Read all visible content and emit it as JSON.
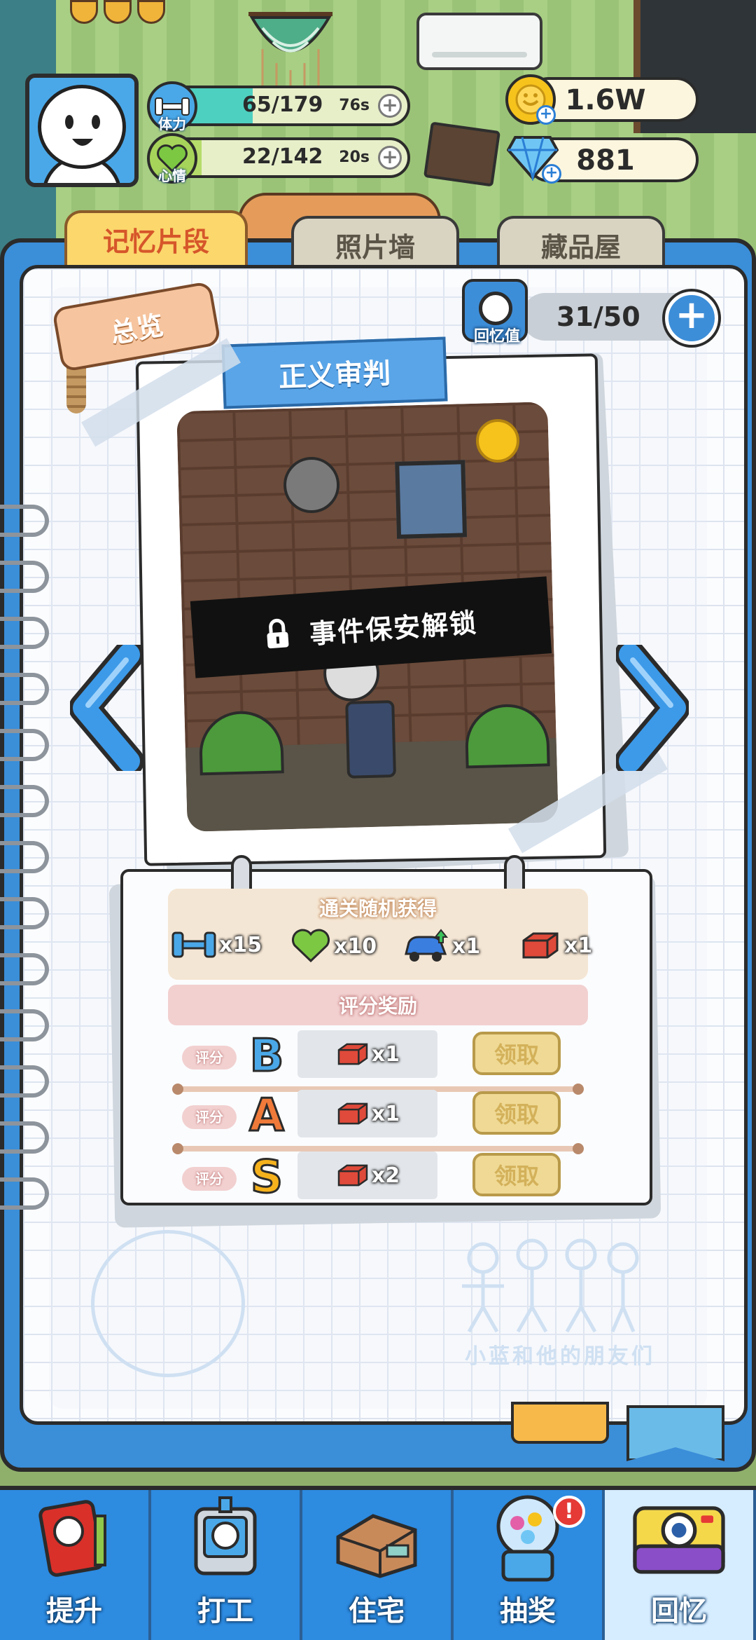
{
  "player": {
    "avatar": "player-avatar",
    "stamina": {
      "label": "体力",
      "value": "65/179",
      "timer": "76s",
      "fill": 0.36,
      "color": "#4ed0c0"
    },
    "mood": {
      "label": "心情",
      "value": "22/142",
      "timer": "20s",
      "fill": 0.15,
      "color": "#b5dc6a"
    }
  },
  "currency": {
    "coins": "1.6W",
    "gems": "881"
  },
  "tabs": [
    {
      "label": "记忆片段",
      "active": true
    },
    {
      "label": "照片墙",
      "active": false
    },
    {
      "label": "藏品屋",
      "active": false
    }
  ],
  "overview": {
    "label": "总览"
  },
  "memory": {
    "label": "回忆值",
    "value": "31/50",
    "plus": "+"
  },
  "event": {
    "title": "正义审判",
    "lock_text": "事件保安解锁"
  },
  "drops": {
    "title": "通关随机获得",
    "items": [
      {
        "icon": "dumbbell-icon",
        "qty": "x15"
      },
      {
        "icon": "heart-icon",
        "qty": "x10"
      },
      {
        "icon": "car-upgrade-icon",
        "qty": "x1"
      },
      {
        "icon": "brick-icon",
        "qty": "x1"
      }
    ]
  },
  "score_rewards": {
    "title": "评分奖励",
    "rows": [
      {
        "tag": "评分",
        "grade": "B",
        "grade_color": "#4aa8e8",
        "reward_qty": "x1",
        "claim": "领取"
      },
      {
        "tag": "评分",
        "grade": "A",
        "grade_color": "#f07a3a",
        "reward_qty": "x1",
        "claim": "领取"
      },
      {
        "tag": "评分",
        "grade": "S",
        "grade_color": "#f6b21c",
        "reward_qty": "x2",
        "claim": "领取"
      }
    ]
  },
  "footer_text": "小蓝和他的朋友们",
  "nav": [
    {
      "label": "提升",
      "icon": "book-icon",
      "badge": ""
    },
    {
      "label": "打工",
      "icon": "id-badge-icon",
      "badge": ""
    },
    {
      "label": "住宅",
      "icon": "house-icon",
      "badge": ""
    },
    {
      "label": "抽奖",
      "icon": "gacha-machine-icon",
      "badge": "!"
    },
    {
      "label": "回忆",
      "icon": "camera-icon",
      "badge": "",
      "active": true
    }
  ]
}
